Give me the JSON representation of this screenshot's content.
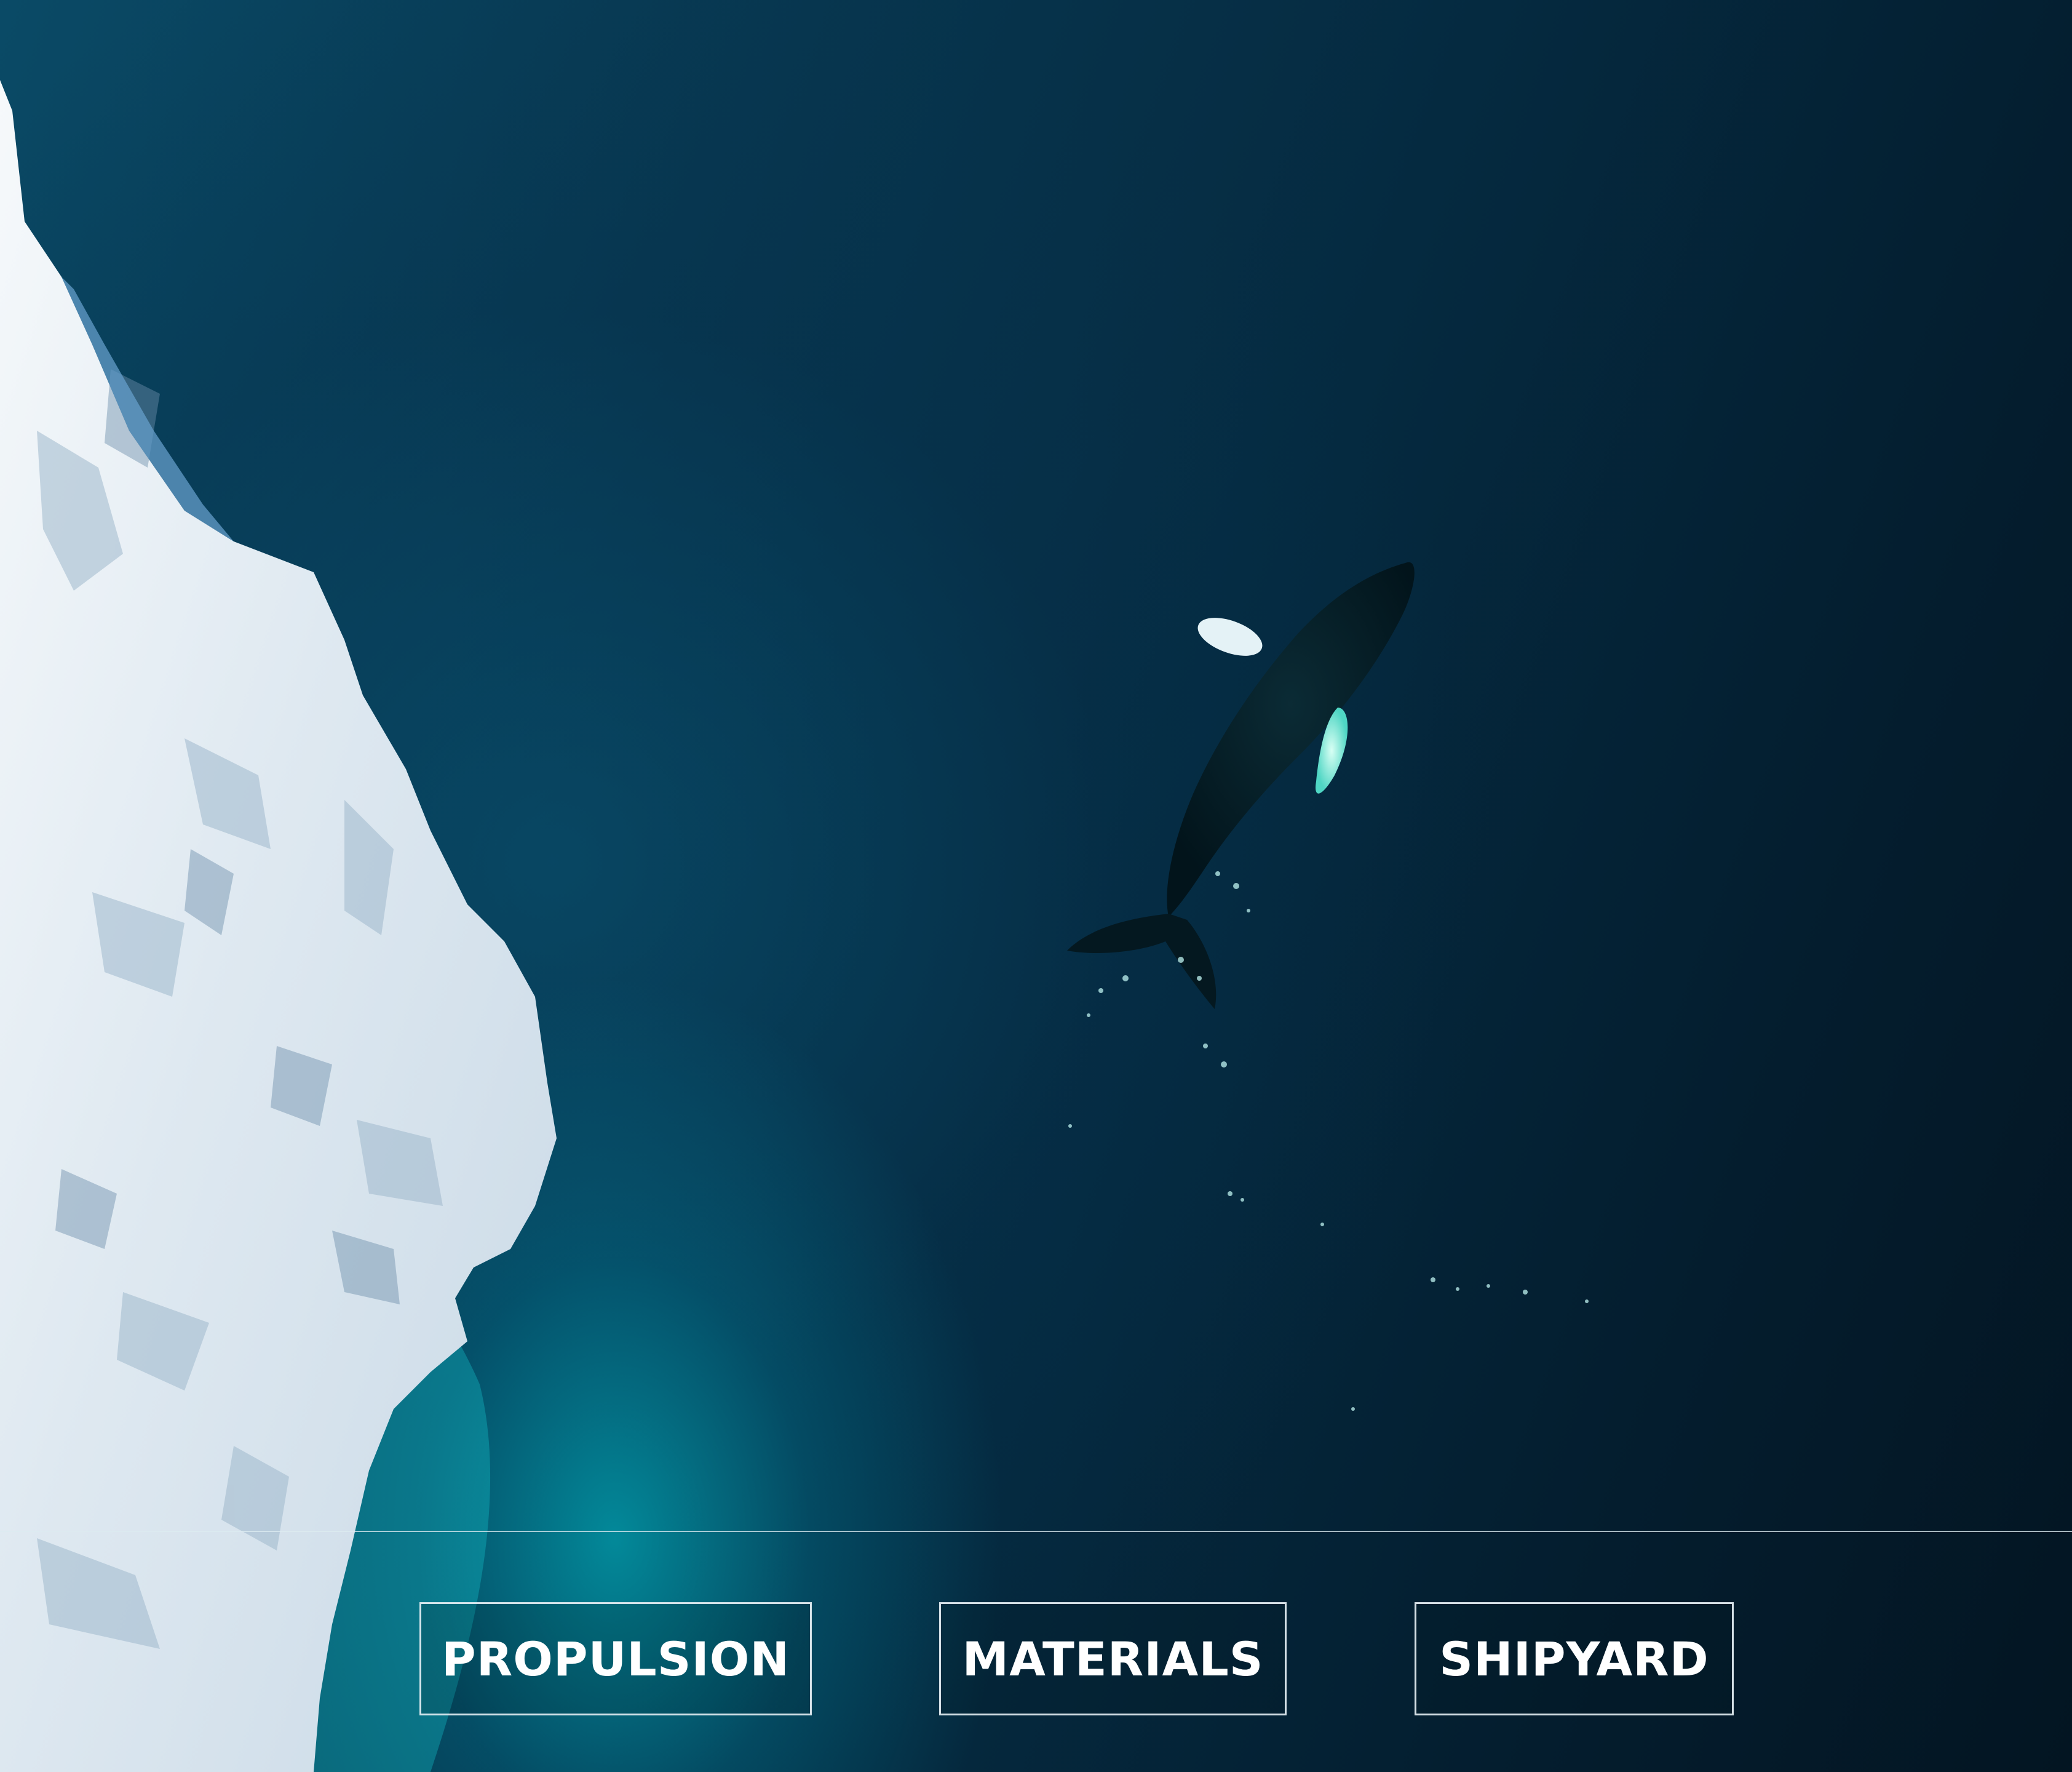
{
  "nav": {
    "buttons": [
      {
        "label": "PROPULSION"
      },
      {
        "label": "MATERIALS"
      },
      {
        "label": "SHIPYARD"
      }
    ]
  },
  "colors": {
    "deep_water": "#031a28",
    "turquoise_glow": "#00d2dc",
    "ice": "#eef3f7",
    "border": "#e6f0f5"
  }
}
